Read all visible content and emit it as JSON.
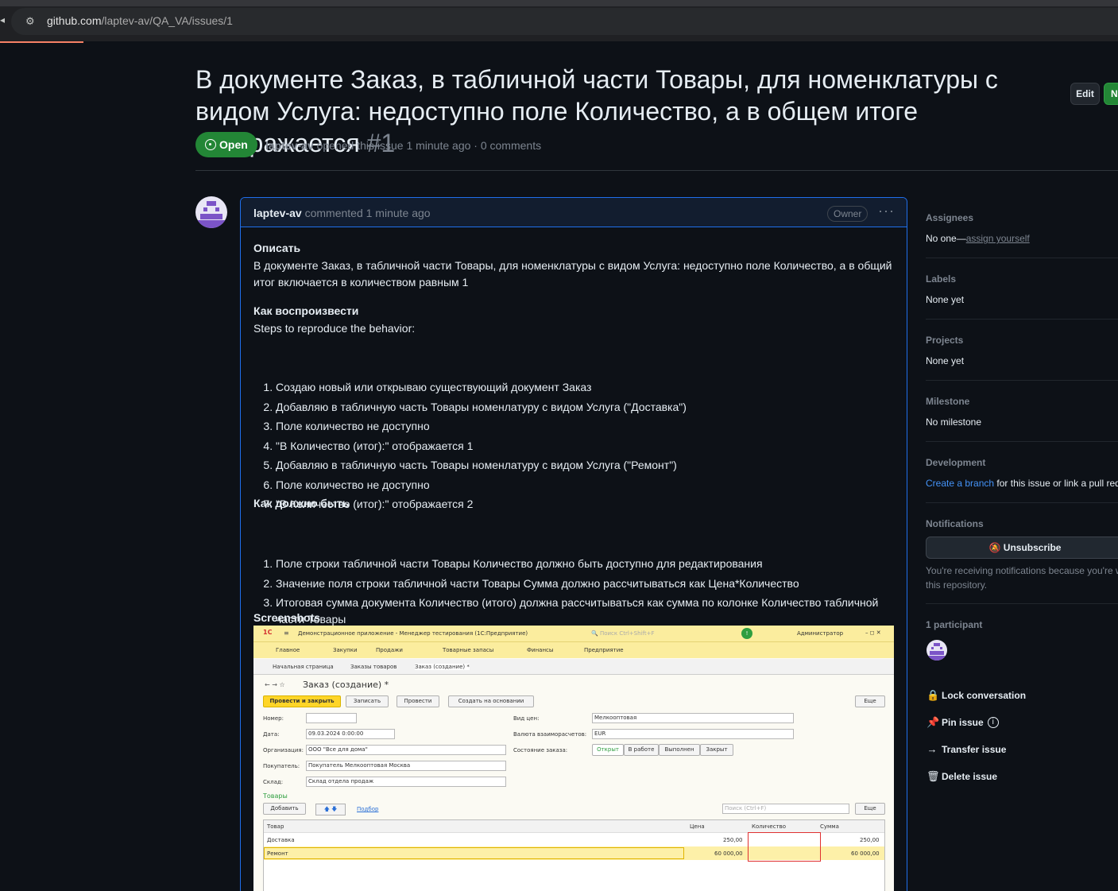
{
  "browser": {
    "url_host": "github.com",
    "url_path": "/laptev-av/QA_VA/issues/1"
  },
  "issue": {
    "title": "В документе Заказ, в табличной части Товары, для номенклатуры с видом Услуга: недоступно поле Количество, а в общем итоге отображается",
    "number": "#1",
    "edit_label": "Edit",
    "new_label": "N",
    "state": "Open",
    "author": "laptev-av",
    "meta_text": "opened this issue 1 minute ago · 0 comments"
  },
  "comment": {
    "author": "laptev-av",
    "time": "commented 1 minute ago",
    "badge": "Owner",
    "menu": "···",
    "h_describe": "Описать",
    "describe_text": "В документе Заказ, в табличной части Товары, для номенклатуры с видом Услуга: недоступно поле Количество, а в общий итог включается в количеством равным 1",
    "h_reproduce": "Как воспроизвести",
    "reproduce_intro": "Steps to reproduce the behavior:",
    "steps": [
      "Создаю новый или открываю существующий документ Заказ",
      "Добавляю в табличную часть Товары номенлатуру с видом Услуга (\"Доставка\")",
      "Поле количество не доступно",
      "\"В Количество (итог):\" отображается 1",
      "Добавляю в табличную часть Товары номенлатуру с видом Услуга (\"Ремонт\")",
      "Поле количество не доступно",
      "\"В Количество (итог):\" отображается 2"
    ],
    "h_expected": "Как должно быть",
    "expected": [
      "Поле строки табличной части Товары Количество должно быть доступно для редактирования",
      "Значение поля строки табличной части Товары Сумма должно рассчитываться как Цена*Количество",
      "Итоговая сумма документа Количество (итого) должна рассчитываться как сумма по колонке Количество табличной части Товары"
    ],
    "h_screenshots": "Screenshots"
  },
  "screenshot": {
    "app_title": "Демонстрационное приложение - Менеджер тестирования (1С:Предприятие)",
    "search_hint": "Поиск Ctrl+Shift+F",
    "user": "Администратор",
    "nav": [
      "Главное",
      "Закупки",
      "Продажи",
      "Товарные запасы",
      "Финансы",
      "Предприятие"
    ],
    "tabs": [
      "Начальная страница",
      "Заказы товаров",
      "Заказ (создание) *"
    ],
    "doc_title": "Заказ (создание) *",
    "btn_post_close": "Провести и закрыть",
    "btn_save": "Записать",
    "btn_post": "Провести",
    "btn_create_based": "Создать на основании",
    "btn_more": "Еще",
    "f_number": "Номер:",
    "f_date": "Дата:",
    "v_date": "09.03.2024  0:00:00",
    "f_org": "Организация:",
    "v_org": "ООО \"Все для дома\"",
    "f_buyer": "Покупатель:",
    "v_buyer": "Покупатель Мелкооптовая Москва",
    "f_store": "Склад:",
    "v_store": "Склад отдела продаж",
    "f_price_type": "Вид цен:",
    "v_price_type": "Мелкооптовая",
    "f_currency": "Валюта взаиморасчетов:",
    "v_currency": "EUR",
    "f_status": "Состояние заказа:",
    "statuses": [
      "Открыт",
      "В работе",
      "Выполнен",
      "Закрыт"
    ],
    "section_goods": "Товары",
    "btn_add": "Добавить",
    "btn_select": "Подбор",
    "table_search": "Поиск (Ctrl+F)",
    "columns": [
      "Товар",
      "Цена",
      "Количество",
      "Сумма"
    ],
    "rows": [
      {
        "item": "Доставка",
        "price": "250,00",
        "qty": "",
        "sum": "250,00"
      },
      {
        "item": "Ремонт",
        "price": "60 000,00",
        "qty": "",
        "sum": "60 000,00"
      }
    ],
    "colors": {
      "accent": "#ffd528",
      "highlight": "#e03030"
    }
  },
  "sidebar": {
    "assignees_label": "Assignees",
    "assignees_value": "No one—",
    "assign_yourself": "assign yourself",
    "labels_label": "Labels",
    "labels_value": "None yet",
    "projects_label": "Projects",
    "projects_value": "None yet",
    "milestone_label": "Milestone",
    "milestone_value": "No milestone",
    "development_label": "Development",
    "dev_link": "Create a branch",
    "dev_text": "for this issue or link a pull req",
    "notifications_label": "Notifications",
    "unsubscribe": "Unsubscribe",
    "notif_note": "You're receiving notifications because you're w this repository.",
    "participants_label": "1 participant",
    "lock": "Lock conversation",
    "pin": "Pin issue",
    "transfer": "Transfer issue",
    "delete": "Delete issue"
  },
  "colors": {
    "bg": "#0d1117",
    "open_green": "#238636",
    "link": "#4493f8",
    "comment_border": "#1f6feb"
  }
}
